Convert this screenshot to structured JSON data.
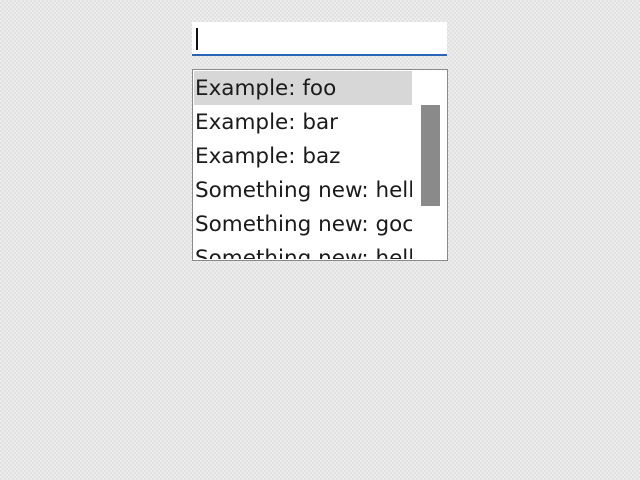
{
  "search": {
    "value": "",
    "placeholder": ""
  },
  "suggestions": {
    "items": [
      {
        "label": "Example: foo"
      },
      {
        "label": "Example: bar"
      },
      {
        "label": "Example: baz"
      },
      {
        "label": "Something new: hell"
      },
      {
        "label": "Something new: goc"
      },
      {
        "label": "Something new: hell"
      }
    ],
    "selected_index": 0
  },
  "colors": {
    "focus_underline": "#2a64b8",
    "selected_row": "#d7d7d7",
    "scroll_thumb": "#8a8a8a"
  }
}
